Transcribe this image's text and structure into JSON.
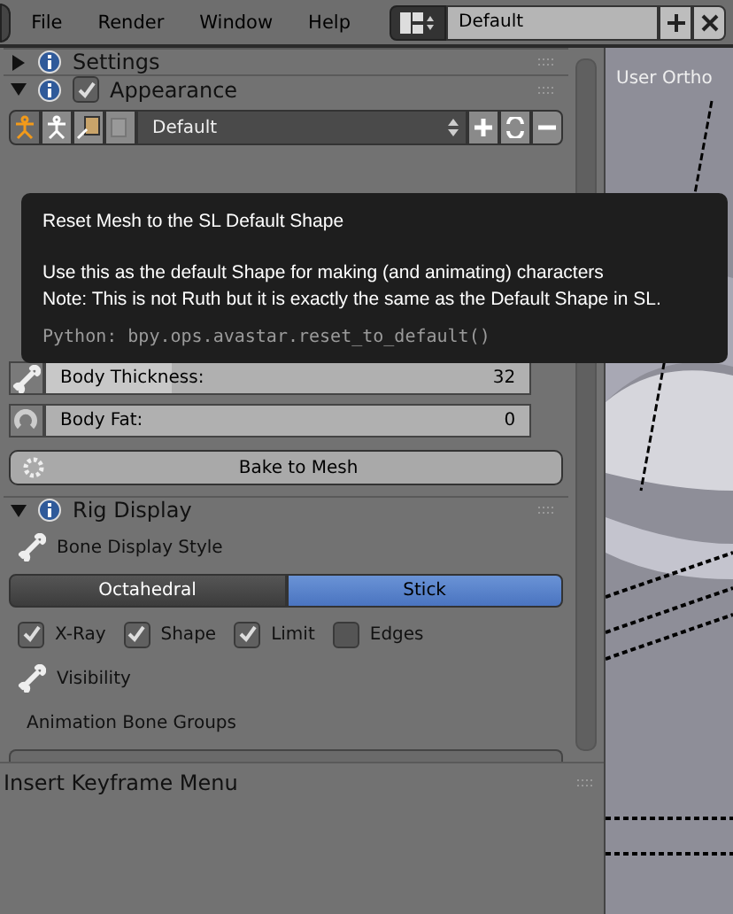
{
  "menu_bar": {
    "menus": [
      "File",
      "Render",
      "Window",
      "Help"
    ],
    "layout_field": {
      "value": "Default"
    }
  },
  "panels": [
    {
      "kind": "collapsed",
      "title": "Settings",
      "expanded": false
    },
    {
      "kind": "appearance",
      "title": "Appearance",
      "expanded": true,
      "checked": true,
      "preset": {
        "value": "Default"
      },
      "sliders": [
        {
          "label": "Body Thickness:",
          "reading": "32",
          "level": 0.26
        },
        {
          "label": "Body Fat:",
          "reading": "0",
          "level": 0.0
        }
      ],
      "button": "Bake to Mesh"
    },
    {
      "kind": "rig",
      "title": "Rig Display",
      "expanded": true,
      "style_label": "Bone Display Style",
      "styles": [
        {
          "label": "Octahedral",
          "selected": false
        },
        {
          "label": "Stick",
          "selected": true
        }
      ],
      "options": [
        {
          "label": "X-Ray",
          "checked": true
        },
        {
          "label": "Shape",
          "checked": true
        },
        {
          "label": "Limit",
          "checked": true
        },
        {
          "label": "Edges",
          "checked": false
        }
      ],
      "visibility_label": "Visibility",
      "groups_label": "Animation Bone Groups"
    }
  ],
  "bottom_panel": {
    "title": "Insert Keyframe Menu"
  },
  "viewport": {
    "label": "User Ortho"
  },
  "tooltip": {
    "title": "Reset Mesh to the SL Default Shape",
    "lines": [
      "Use this as the default Shape for making (and animating) characters",
      "Note: This is not Ruth but it is exactly the same as the Default Shape in SL."
    ],
    "python": "Python: bpy.ops.avastar.reset_to_default()"
  }
}
